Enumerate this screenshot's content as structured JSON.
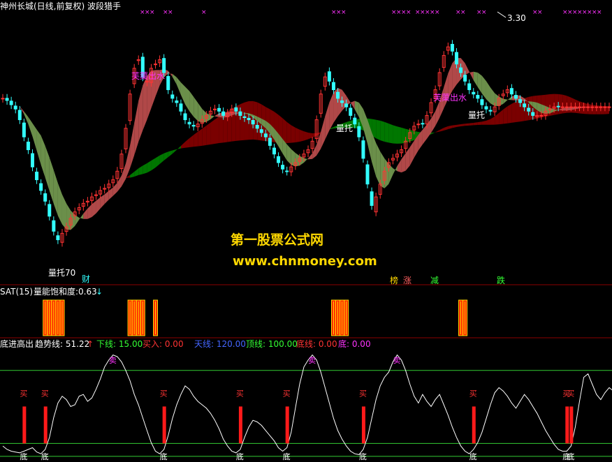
{
  "colors": {
    "background": "#000000",
    "divider": "#8b0000",
    "bull_candle": "#ff3333",
    "bear_candle": "#33ffff",
    "magenta": "#ff33ff",
    "yellow": "#ffd800",
    "green_band": "#007700",
    "red_band": "#7a0000",
    "olive_band": "#6b8f4a",
    "rose_band": "#b04848",
    "green_line": "#33cc33",
    "white_line": "#ffffff"
  },
  "main_panel": {
    "title": "神州长城(日线,前复权) 波段猎手",
    "price_label": "3.30",
    "annotations": [
      {
        "text": "芙蕖出水",
        "color": "#ff33ff"
      },
      {
        "text": "芙蕖出水",
        "color": "#ff33ff"
      },
      {
        "text": "量托",
        "color": "#ffffff"
      },
      {
        "text": "量托",
        "color": "#ffffff"
      },
      {
        "text": "量托70",
        "color": "#ffffff"
      }
    ],
    "event_tags": [
      {
        "text": "财",
        "color": "#33ffff"
      },
      {
        "text": "榜",
        "color": "#ffd800"
      },
      {
        "text": "涨",
        "color": "#ff6060"
      },
      {
        "text": "减",
        "color": "#33ff33"
      },
      {
        "text": "跌",
        "color": "#33ff33"
      }
    ]
  },
  "watermark": {
    "line1": "第一股票公式网",
    "line2": "www.chnmoney.com"
  },
  "mid_panel": {
    "title_prefix": "SAT(15)",
    "title_name": "量能饱和度:",
    "title_value": "0.63",
    "arrow": "↓"
  },
  "low_panel": {
    "title": "底进高出",
    "items": [
      {
        "text": "趋势线: 51.22",
        "color": "#ffffff"
      },
      {
        "text": "↑",
        "color": "#ff3333"
      },
      {
        "text": "下线: 15.00",
        "color": "#33ff33"
      },
      {
        "text": "买入: 0.00",
        "color": "#ff3333"
      },
      {
        "text": "天线: 120.00",
        "color": "#3333ff"
      },
      {
        "text": "顶线: 100.00",
        "color": "#33ff33"
      },
      {
        "text": "底线: 0.00",
        "color": "#ff3333"
      },
      {
        "text": "底: 0.00",
        "color": "#ff33ff"
      }
    ],
    "sell_mark": "卖",
    "buy_mark": "买",
    "bottom_mark": "底"
  },
  "chart_data": [
    {
      "type": "candlestick",
      "title": "神州长城(日线,前复权) 波段猎手",
      "ylim": [
        2.12,
        3.38
      ],
      "x": [
        1,
        2,
        3,
        4,
        5,
        6,
        7,
        8,
        9,
        10,
        11,
        12,
        13,
        14,
        15,
        16,
        17,
        18,
        19,
        20,
        21,
        22,
        23,
        24,
        25,
        26,
        27,
        28,
        29,
        30,
        31,
        32,
        33,
        34,
        35,
        36,
        37,
        38,
        39,
        40,
        41,
        42,
        43,
        44,
        45,
        46,
        47,
        48,
        49,
        50,
        51,
        52,
        53,
        54,
        55,
        56,
        57,
        58,
        59,
        60,
        61,
        62,
        63,
        64,
        65,
        66,
        67,
        68,
        69,
        70,
        71,
        72,
        73,
        74,
        75,
        76,
        77,
        78,
        79,
        80,
        81,
        82,
        83,
        84,
        85,
        86,
        87,
        88,
        89,
        90,
        91,
        92,
        93,
        94,
        95,
        96,
        97,
        98,
        99,
        100,
        101,
        102,
        103,
        104,
        105,
        106,
        107,
        108,
        109,
        110,
        111,
        112,
        113,
        114,
        115,
        116,
        117,
        118,
        119,
        120,
        121,
        122,
        123,
        124,
        125,
        126,
        127,
        128,
        129,
        130,
        131,
        132,
        133,
        134,
        135,
        136,
        137,
        138,
        139,
        140,
        141,
        142,
        143,
        144,
        145
      ],
      "close": [
        2.98,
        2.97,
        2.95,
        2.93,
        2.88,
        2.8,
        2.74,
        2.66,
        2.6,
        2.55,
        2.5,
        2.43,
        2.36,
        2.32,
        2.35,
        2.38,
        2.42,
        2.45,
        2.47,
        2.49,
        2.5,
        2.52,
        2.53,
        2.55,
        2.56,
        2.58,
        2.6,
        2.64,
        2.72,
        2.84,
        3.0,
        3.12,
        3.16,
        3.08,
        3.06,
        3.12,
        3.14,
        3.16,
        3.1,
        3.02,
        2.98,
        2.96,
        2.92,
        2.88,
        2.86,
        2.85,
        2.86,
        2.88,
        2.9,
        2.92,
        2.93,
        2.92,
        2.9,
        2.91,
        2.93,
        2.92,
        2.9,
        2.89,
        2.88,
        2.86,
        2.84,
        2.82,
        2.8,
        2.76,
        2.72,
        2.68,
        2.65,
        2.64,
        2.66,
        2.68,
        2.7,
        2.72,
        2.74,
        2.78,
        2.88,
        3.0,
        3.08,
        3.06,
        3.02,
        2.98,
        2.96,
        2.94,
        2.9,
        2.86,
        2.8,
        2.7,
        2.58,
        2.48,
        2.52,
        2.58,
        2.64,
        2.68,
        2.7,
        2.72,
        2.74,
        2.78,
        2.82,
        2.85,
        2.86,
        2.86,
        2.9,
        2.96,
        3.02,
        3.1,
        3.18,
        3.22,
        3.2,
        3.14,
        3.1,
        3.06,
        3.02,
        3.0,
        2.98,
        2.95,
        2.93,
        2.92,
        2.94,
        2.98,
        3.0,
        3.02,
        3.0,
        2.98,
        2.96,
        2.94,
        2.92,
        2.9,
        2.9,
        2.9,
        2.92,
        2.93,
        2.94,
        2.94,
        2.94,
        2.94,
        2.94,
        2.94,
        2.94,
        2.94,
        2.94,
        2.94,
        2.94,
        2.94,
        2.94,
        2.94
      ]
    },
    {
      "type": "bar",
      "title": "SAT(15) 量能饱和度",
      "x": [
        1,
        2,
        3,
        4,
        5,
        6,
        7,
        8,
        9,
        10,
        11,
        12,
        13,
        14,
        15,
        16,
        17,
        18,
        19,
        20,
        21,
        22,
        23,
        24,
        25,
        26,
        27,
        28,
        29,
        30,
        31,
        32,
        33,
        34,
        35,
        36,
        37,
        38,
        39,
        40,
        41,
        42,
        43,
        44,
        45,
        46,
        47,
        48,
        49,
        50,
        51,
        52,
        53,
        54,
        55,
        56,
        57,
        58,
        59,
        60,
        61,
        62,
        63,
        64,
        65,
        66,
        67,
        68,
        69,
        70,
        71,
        72,
        73,
        74,
        75,
        76,
        77,
        78,
        79,
        80,
        81,
        82,
        83,
        84,
        85,
        86,
        87,
        88,
        89,
        90,
        91,
        92,
        93,
        94,
        95,
        96,
        97,
        98,
        99,
        100,
        101,
        102,
        103,
        104,
        105,
        106,
        107,
        108,
        109,
        110,
        111,
        112,
        113,
        114,
        115,
        116,
        117,
        118,
        119,
        120,
        121,
        122,
        123,
        124,
        125,
        126,
        127,
        128,
        129,
        130,
        131,
        132,
        133,
        134,
        135,
        136,
        137,
        138,
        139,
        140,
        141,
        142,
        143,
        144,
        145
      ],
      "values": [
        0,
        0,
        0,
        0,
        0,
        0,
        0,
        0,
        0,
        0,
        1,
        1,
        1,
        1,
        1,
        0,
        0,
        0,
        0,
        0,
        0,
        0,
        0,
        0,
        0,
        0,
        0,
        0,
        0,
        0,
        1,
        1,
        1,
        1,
        0,
        0,
        1,
        0,
        0,
        0,
        0,
        0,
        0,
        0,
        0,
        0,
        0,
        0,
        0,
        0,
        0,
        0,
        0,
        0,
        0,
        0,
        0,
        0,
        0,
        0,
        0,
        0,
        0,
        0,
        0,
        0,
        0,
        0,
        0,
        0,
        0,
        0,
        0,
        0,
        0,
        0,
        0,
        0,
        1,
        1,
        1,
        1,
        0,
        0,
        0,
        0,
        0,
        0,
        0,
        0,
        0,
        0,
        0,
        0,
        0,
        0,
        0,
        0,
        0,
        0,
        0,
        0,
        0,
        0,
        0,
        0,
        0,
        0,
        1,
        1,
        0,
        0,
        0,
        0,
        0,
        0,
        0,
        0,
        0,
        0,
        0,
        0,
        0,
        0,
        0,
        0,
        0,
        0,
        0,
        0,
        0,
        0,
        0,
        0,
        0,
        0,
        0,
        0,
        0,
        0,
        0,
        0,
        0,
        0,
        0
      ]
    },
    {
      "type": "line",
      "title": "底进高出",
      "ylim": [
        -5,
        125
      ],
      "x": [
        1,
        2,
        3,
        4,
        5,
        6,
        7,
        8,
        9,
        10,
        11,
        12,
        13,
        14,
        15,
        16,
        17,
        18,
        19,
        20,
        21,
        22,
        23,
        24,
        25,
        26,
        27,
        28,
        29,
        30,
        31,
        32,
        33,
        34,
        35,
        36,
        37,
        38,
        39,
        40,
        41,
        42,
        43,
        44,
        45,
        46,
        47,
        48,
        49,
        50,
        51,
        52,
        53,
        54,
        55,
        56,
        57,
        58,
        59,
        60,
        61,
        62,
        63,
        64,
        65,
        66,
        67,
        68,
        69,
        70,
        71,
        72,
        73,
        74,
        75,
        76,
        77,
        78,
        79,
        80,
        81,
        82,
        83,
        84,
        85,
        86,
        87,
        88,
        89,
        90,
        91,
        92,
        93,
        94,
        95,
        96,
        97,
        98,
        99,
        100,
        101,
        102,
        103,
        104,
        105,
        106,
        107,
        108,
        109,
        110,
        111,
        112,
        113,
        114,
        115,
        116,
        117,
        118,
        119,
        120,
        121,
        122,
        123,
        124,
        125,
        126,
        127,
        128,
        129,
        130,
        131,
        132,
        133,
        134,
        135,
        136,
        137,
        138,
        139,
        140,
        141,
        142,
        143,
        144,
        145
      ],
      "series": [
        {
          "name": "趋势线",
          "values": [
            12,
            8,
            6,
            5,
            4,
            6,
            8,
            10,
            5,
            3,
            8,
            22,
            45,
            62,
            70,
            66,
            58,
            60,
            70,
            72,
            64,
            68,
            78,
            90,
            104,
            112,
            118,
            116,
            110,
            100,
            88,
            72,
            60,
            45,
            30,
            16,
            6,
            3,
            8,
            24,
            44,
            60,
            72,
            82,
            78,
            70,
            64,
            60,
            56,
            50,
            42,
            32,
            20,
            12,
            6,
            4,
            8,
            22,
            34,
            42,
            40,
            36,
            30,
            24,
            18,
            10,
            6,
            10,
            28,
            56,
            84,
            104,
            112,
            118,
            112,
            98,
            80,
            62,
            44,
            30,
            20,
            12,
            6,
            3,
            2,
            8,
            22,
            44,
            66,
            82,
            92,
            98,
            110,
            118,
            112,
            100,
            84,
            70,
            62,
            72,
            64,
            58,
            66,
            72,
            60,
            48,
            34,
            22,
            12,
            6,
            3,
            8,
            16,
            28,
            44,
            60,
            74,
            80,
            76,
            70,
            62,
            56,
            64,
            72,
            66,
            58,
            50,
            40,
            30,
            22,
            14,
            8,
            6,
            6,
            12,
            34,
            64,
            92,
            96,
            84,
            72,
            66,
            74,
            80,
            76
          ]
        }
      ],
      "reference_lines": [
        {
          "name": "顶线",
          "value": 100
        },
        {
          "name": "下线",
          "value": 15
        },
        {
          "name": "底线",
          "value": 0
        }
      ]
    }
  ]
}
